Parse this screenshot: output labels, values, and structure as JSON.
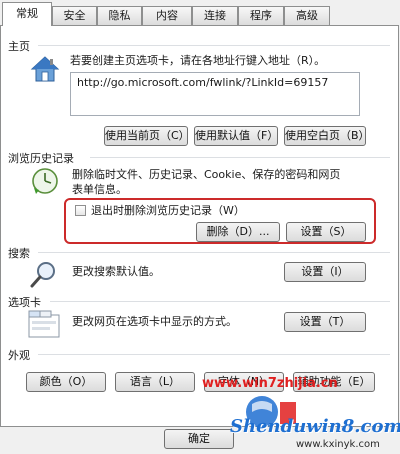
{
  "tabs": [
    "常规",
    "安全",
    "隐私",
    "内容",
    "连接",
    "程序",
    "高级"
  ],
  "home": {
    "title": "主页",
    "desc": "若要创建主页选项卡，请在各地址行键入地址（R）。",
    "url": "http://go.microsoft.com/fwlink/?LinkId=69157",
    "btn_current": "使用当前页（C）",
    "btn_default": "使用默认值（F）",
    "btn_blank": "使用空白页（B）"
  },
  "history": {
    "title": "浏览历史记录",
    "desc_line1": "删除临时文件、历史记录、Cookie、保存的密码和网页",
    "desc_line2": "表单信息。",
    "checkbox_label": "退出时删除浏览历史记录（W）",
    "btn_delete": "删除（D）...",
    "btn_settings": "设置（S）"
  },
  "search": {
    "title": "搜索",
    "desc": "更改搜索默认值。",
    "btn_settings": "设置（I）"
  },
  "tabs_section": {
    "title": "选项卡",
    "desc": "更改网页在选项卡中显示的方式。",
    "btn_settings": "设置（T）"
  },
  "appearance": {
    "title": "外观",
    "btn_colors": "颜色（O）",
    "btn_language": "语言（L）",
    "btn_fonts": "字体（N）",
    "btn_accessibility": "辅助功能（E）"
  },
  "footer": {
    "ok": "确定"
  },
  "watermark": {
    "site1": "www.win7zhijia.cn",
    "brand": "Shenduwin8.com",
    "site2": "www.kxinyk.com"
  },
  "colors": {
    "highlight": "#cc2a2a",
    "watermark_red": "#e02020",
    "watermark_blue": "#1e6fd1"
  }
}
